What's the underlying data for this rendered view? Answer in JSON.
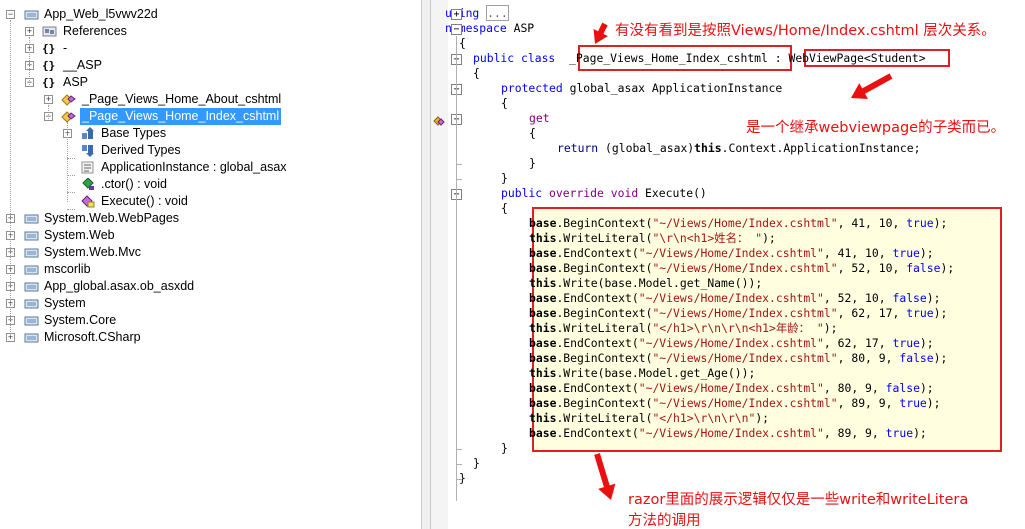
{
  "tree": {
    "items": [
      {
        "label": "App_Web_l5vwv22d"
      },
      {
        "label": "References"
      },
      {
        "label": "-"
      },
      {
        "label": "__ASP"
      },
      {
        "label": "ASP"
      },
      {
        "label": "_Page_Views_Home_About_cshtml"
      },
      {
        "label": "_Page_Views_Home_Index_cshtml"
      },
      {
        "label": "Base Types"
      },
      {
        "label": "Derived Types"
      },
      {
        "label": "ApplicationInstance : global_asax"
      },
      {
        "label": ".ctor() : void"
      },
      {
        "label": "Execute() : void"
      },
      {
        "label": "System.Web.WebPages"
      },
      {
        "label": "System.Web"
      },
      {
        "label": "System.Web.Mvc"
      },
      {
        "label": "mscorlib"
      },
      {
        "label": "App_global.asax.ob_asxdd"
      },
      {
        "label": "System"
      },
      {
        "label": "System.Core"
      },
      {
        "label": "Microsoft.CSharp"
      }
    ],
    "ns_glyph": "{}",
    "expand_glyph": "+",
    "collapse_glyph": "−"
  },
  "code": {
    "using_kw": "using",
    "using_fold": "...",
    "ns_kw": "namespace",
    "ns_name": "ASP",
    "open_brace": "{",
    "close_brace": "}",
    "class_kw": "public class",
    "class_name": "_Page_Views_Home_Index_cshtml",
    "class_colon": ":",
    "base_class": "WebViewPage<Student>",
    "prop_kw": "protected",
    "prop_type": "global_asax",
    "prop_name": "ApplicationInstance",
    "get_kw": "get",
    "return_kw": "return",
    "return_expr_a": "(global_asax)",
    "this_kw": "this",
    "return_expr_b": ".Context.ApplicationInstance;",
    "method_kw1": "public",
    "method_kw2": "override",
    "method_kw3": "void",
    "method_name": "Execute",
    "method_parens": "()",
    "body_lines": [
      {
        "obj": "base",
        "dot": ".",
        "method": "BeginContext",
        "open": "(",
        "str": "\"~/Views/Home/Index.cshtml\"",
        "rest": ", 41, 10, ",
        "bool": "true",
        "close": ");"
      },
      {
        "obj": "this",
        "dot": ".",
        "method": "WriteLiteral",
        "open": "(",
        "str": "\"\\r\\n<h1>姓名： \"",
        "rest": "",
        "bool": "",
        "close": ");"
      },
      {
        "obj": "base",
        "dot": ".",
        "method": "EndContext",
        "open": "(",
        "str": "\"~/Views/Home/Index.cshtml\"",
        "rest": ", 41, 10, ",
        "bool": "true",
        "close": ");"
      },
      {
        "obj": "base",
        "dot": ".",
        "method": "BeginContext",
        "open": "(",
        "str": "\"~/Views/Home/Index.cshtml\"",
        "rest": ", 52, 10, ",
        "bool": "false",
        "close": ");"
      },
      {
        "obj": "this",
        "dot": ".",
        "method": "Write",
        "open": "(",
        "str": "",
        "rest": "base.Model.get_Name()",
        "bool": "",
        "close": ");"
      },
      {
        "obj": "base",
        "dot": ".",
        "method": "EndContext",
        "open": "(",
        "str": "\"~/Views/Home/Index.cshtml\"",
        "rest": ", 52, 10, ",
        "bool": "false",
        "close": ");"
      },
      {
        "obj": "base",
        "dot": ".",
        "method": "BeginContext",
        "open": "(",
        "str": "\"~/Views/Home/Index.cshtml\"",
        "rest": ", 62, 17, ",
        "bool": "true",
        "close": ");"
      },
      {
        "obj": "this",
        "dot": ".",
        "method": "WriteLiteral",
        "open": "(",
        "str": "\"</h1>\\r\\n\\r\\n<h1>年龄： \"",
        "rest": "",
        "bool": "",
        "close": ");"
      },
      {
        "obj": "base",
        "dot": ".",
        "method": "EndContext",
        "open": "(",
        "str": "\"~/Views/Home/Index.cshtml\"",
        "rest": ", 62, 17, ",
        "bool": "true",
        "close": ");"
      },
      {
        "obj": "base",
        "dot": ".",
        "method": "BeginContext",
        "open": "(",
        "str": "\"~/Views/Home/Index.cshtml\"",
        "rest": ", 80, 9, ",
        "bool": "false",
        "close": ");"
      },
      {
        "obj": "this",
        "dot": ".",
        "method": "Write",
        "open": "(",
        "str": "",
        "rest": "base.Model.get_Age()",
        "bool": "",
        "close": ");"
      },
      {
        "obj": "base",
        "dot": ".",
        "method": "EndContext",
        "open": "(",
        "str": "\"~/Views/Home/Index.cshtml\"",
        "rest": ", 80, 9, ",
        "bool": "false",
        "close": ");"
      },
      {
        "obj": "base",
        "dot": ".",
        "method": "BeginContext",
        "open": "(",
        "str": "\"~/Views/Home/Index.cshtml\"",
        "rest": ", 89, 9, ",
        "bool": "true",
        "close": ");"
      },
      {
        "obj": "this",
        "dot": ".",
        "method": "WriteLiteral",
        "open": "(",
        "str": "\"</h1>\\r\\n\\r\\n\"",
        "rest": "",
        "bool": "",
        "close": ");"
      },
      {
        "obj": "base",
        "dot": ".",
        "method": "EndContext",
        "open": "(",
        "str": "\"~/Views/Home/Index.cshtml\"",
        "rest": ", 89, 9, ",
        "bool": "true",
        "close": ");"
      }
    ]
  },
  "annotations": {
    "note1": "有没有看到是按照Views/Home/Index.cshtml 层次关系。",
    "note2": "是一个继承webviewpage的子类而已。",
    "note3_line1": "razor里面的展示逻辑仅仅是一些write和writeLitera",
    "note3_line2": "方法的调用"
  },
  "colors": {
    "keyword": "#0000ff",
    "string": "#a31515",
    "annotation": "#e81010",
    "highlight_box": "#e02020",
    "code_box_bg": "#ffffe0",
    "selection": "#3399ff"
  }
}
